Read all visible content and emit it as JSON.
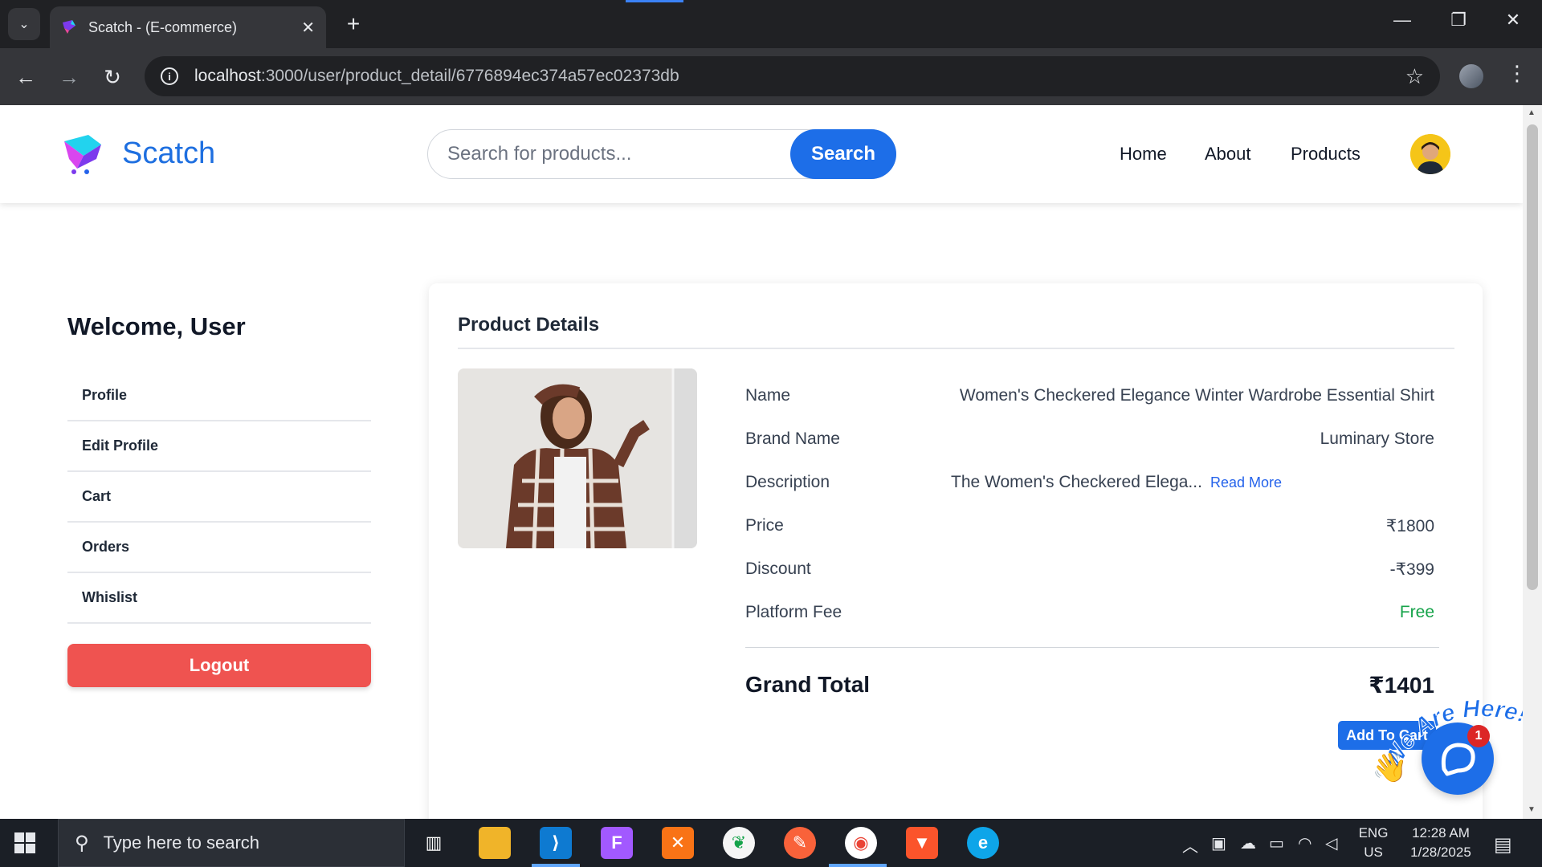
{
  "browser": {
    "tab_title": "Scatch - (E-commerce)",
    "url_host": "localhost",
    "url_rest": ":3000/user/product_detail/6776894ec374a57ec02373db"
  },
  "header": {
    "brand": "Scatch",
    "search_placeholder": "Search for products...",
    "search_button": "Search",
    "nav": [
      "Home",
      "About",
      "Products"
    ]
  },
  "sidebar": {
    "welcome": "Welcome, User",
    "items": [
      "Profile",
      "Edit Profile",
      "Cart",
      "Orders",
      "Whislist"
    ],
    "logout": "Logout"
  },
  "product": {
    "section_title": "Product Details",
    "rows": [
      {
        "label": "Name",
        "value": "Women's Checkered Elegance Winter Wardrobe Essential Shirt"
      },
      {
        "label": "Brand Name",
        "value": "Luminary Store"
      },
      {
        "label": "Description",
        "value": "The Women's Checkered Elega...",
        "link": "Read More"
      },
      {
        "label": "Price",
        "value": "₹1800"
      },
      {
        "label": "Discount",
        "value": "-₹399"
      },
      {
        "label": "Platform Fee",
        "value": "Free"
      }
    ],
    "grand_total_label": "Grand Total",
    "grand_total_value": "₹1401",
    "add_to_cart": "Add To Cart"
  },
  "chat": {
    "bubble_text": "We Are Here!",
    "badge_count": "1"
  },
  "taskbar": {
    "search_placeholder": "Type here to search",
    "lang_1": "ENG",
    "lang_2": "US",
    "time": "12:28 AM",
    "date": "1/28/2025"
  },
  "colors": {
    "brand_blue": "#1d6ee8",
    "logout_red": "#ef5350",
    "free_green": "#16a34a"
  }
}
